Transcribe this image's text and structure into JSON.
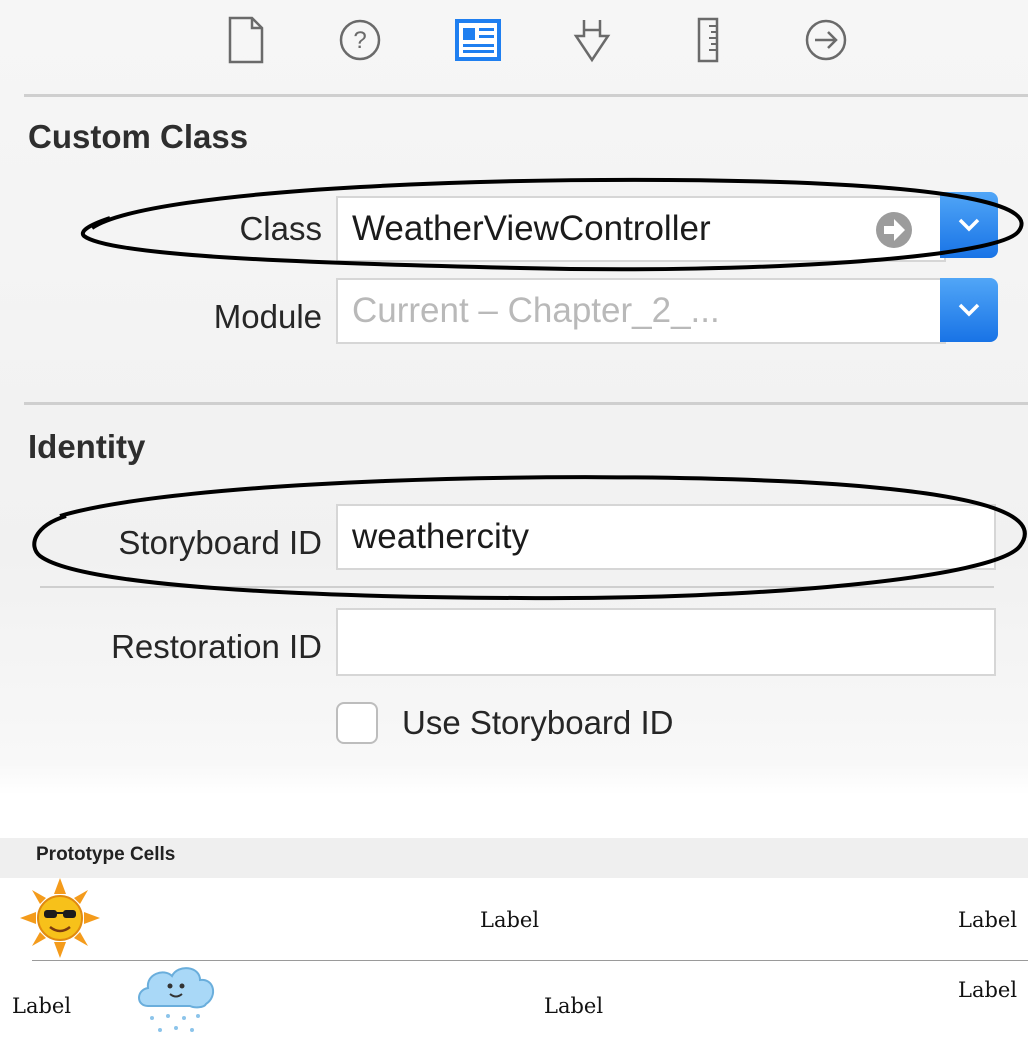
{
  "toolbar": {
    "tabs": [
      {
        "name": "file-inspector",
        "icon": "document-icon"
      },
      {
        "name": "quick-help",
        "icon": "question-icon"
      },
      {
        "name": "identity-inspector",
        "icon": "identity-icon",
        "selected": true
      },
      {
        "name": "attributes-inspector",
        "icon": "attributes-icon"
      },
      {
        "name": "size-inspector",
        "icon": "ruler-icon"
      },
      {
        "name": "connections-inspector",
        "icon": "arrow-right-circle-icon"
      }
    ]
  },
  "custom_class": {
    "title": "Custom Class",
    "class_label": "Class",
    "class_value": "WeatherViewController",
    "module_label": "Module",
    "module_value": "Current – Chapter_2_..."
  },
  "identity": {
    "title": "Identity",
    "storyboard_id_label": "Storyboard ID",
    "storyboard_id_value": "weathercity",
    "restoration_id_label": "Restoration ID",
    "restoration_id_value": "",
    "use_storyboard_id_label": "Use Storyboard ID",
    "use_storyboard_id_checked": false
  },
  "prototype": {
    "title": "Prototype Cells",
    "rows": [
      {
        "image": "sun-icon",
        "labels": [
          "Label",
          "Label"
        ]
      },
      {
        "image": "rain-cloud-icon",
        "labels": [
          "Label",
          "Label",
          "Label"
        ]
      }
    ]
  },
  "colors": {
    "accent": "#1f7ff0",
    "annotation": "#000000"
  }
}
